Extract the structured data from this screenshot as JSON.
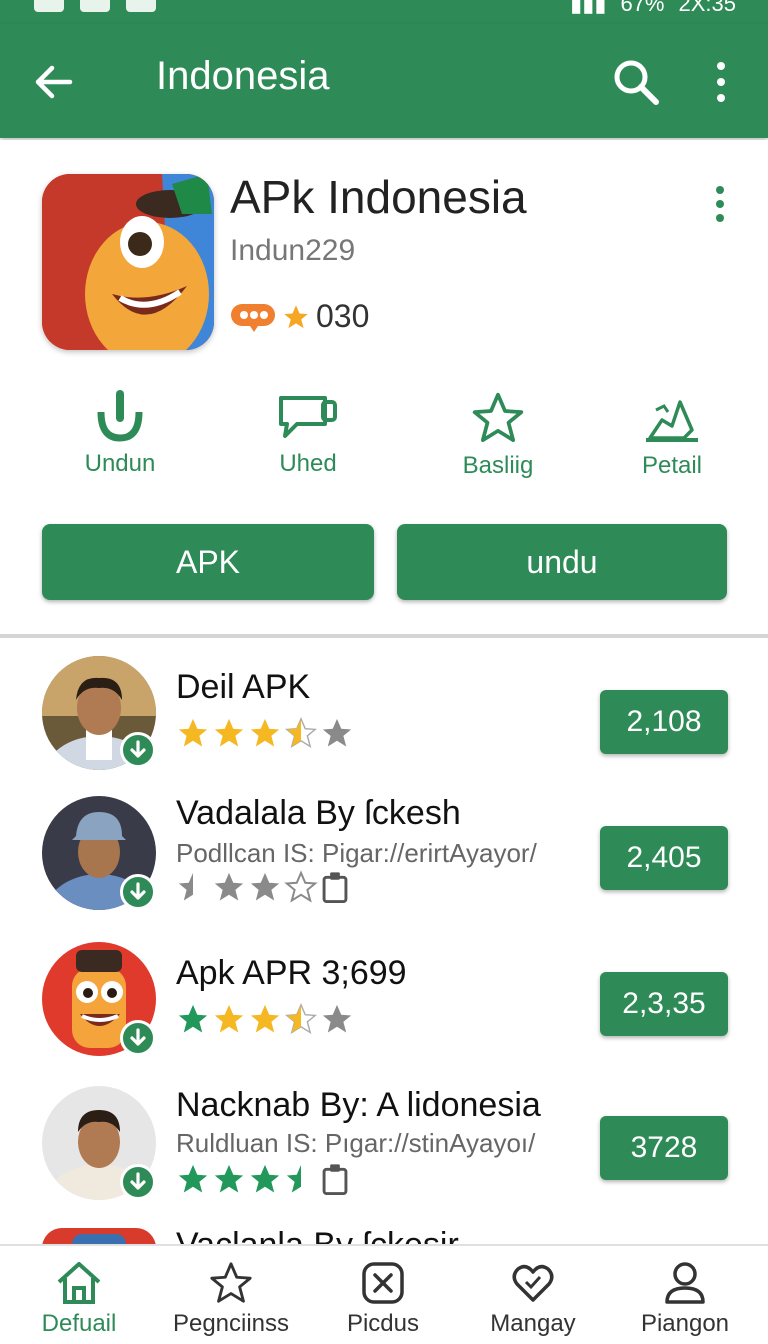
{
  "status_bar": {
    "battery": "67%",
    "time": "2X:35"
  },
  "app_bar": {
    "title": "Indonesia",
    "back_icon": "arrow-back-icon",
    "search_icon": "search-icon",
    "more_icon": "more-vert-icon"
  },
  "app": {
    "name": "APk Indonesia",
    "developer": "Indun229",
    "rating_count": "030",
    "accent_color": "#2e8b57"
  },
  "actions": [
    {
      "label": "Undun",
      "icon": "download-icon"
    },
    {
      "label": "Uhed",
      "icon": "chat-icon"
    },
    {
      "label": "Basliig",
      "icon": "star-icon"
    },
    {
      "label": "Petail",
      "icon": "detail-icon"
    }
  ],
  "buttons": {
    "primary": "APK",
    "secondary": "undu"
  },
  "list": [
    {
      "title": "Deil APK",
      "subtitle": "",
      "count": "2,108",
      "rating": 3.5
    },
    {
      "title": "Vadalala By ſckesh",
      "subtitle": "Podllcan IS: Pigar://erirtAyayor/",
      "count": "2,405",
      "rating": 2
    },
    {
      "title": "Apk APR 3;699",
      "subtitle": "",
      "count": "2,3,35",
      "rating": 3.5
    },
    {
      "title": "Nacknab By: A lidonesia",
      "subtitle": "Ruldluan IS: Pıgar://stinAyayoı/",
      "count": "3728",
      "rating": 3.5
    },
    {
      "title": "Vaclanla By ſckesir",
      "subtitle": "",
      "count": "",
      "rating": 0
    }
  ],
  "bottom_nav": [
    {
      "label": "Defuail",
      "icon": "home-icon",
      "active": true
    },
    {
      "label": "Pegnciinss",
      "icon": "star-outline-icon",
      "active": false
    },
    {
      "label": "Picdus",
      "icon": "close-box-icon",
      "active": false
    },
    {
      "label": "Mangay",
      "icon": "heart-icon",
      "active": false
    },
    {
      "label": "Piangon",
      "icon": "person-icon",
      "active": false
    }
  ]
}
